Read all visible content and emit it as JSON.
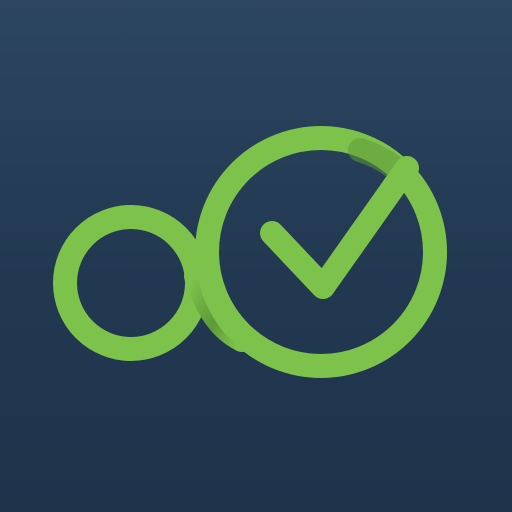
{
  "app_icon": {
    "name": "logo-icon",
    "background_color_top": "#2c4561",
    "background_color_bottom": "#1f334b",
    "accent_color": "#7dc24b",
    "accent_shadow_color": "#5f9a3a",
    "elements": [
      "small-ring",
      "large-ring-with-checkmark"
    ]
  }
}
